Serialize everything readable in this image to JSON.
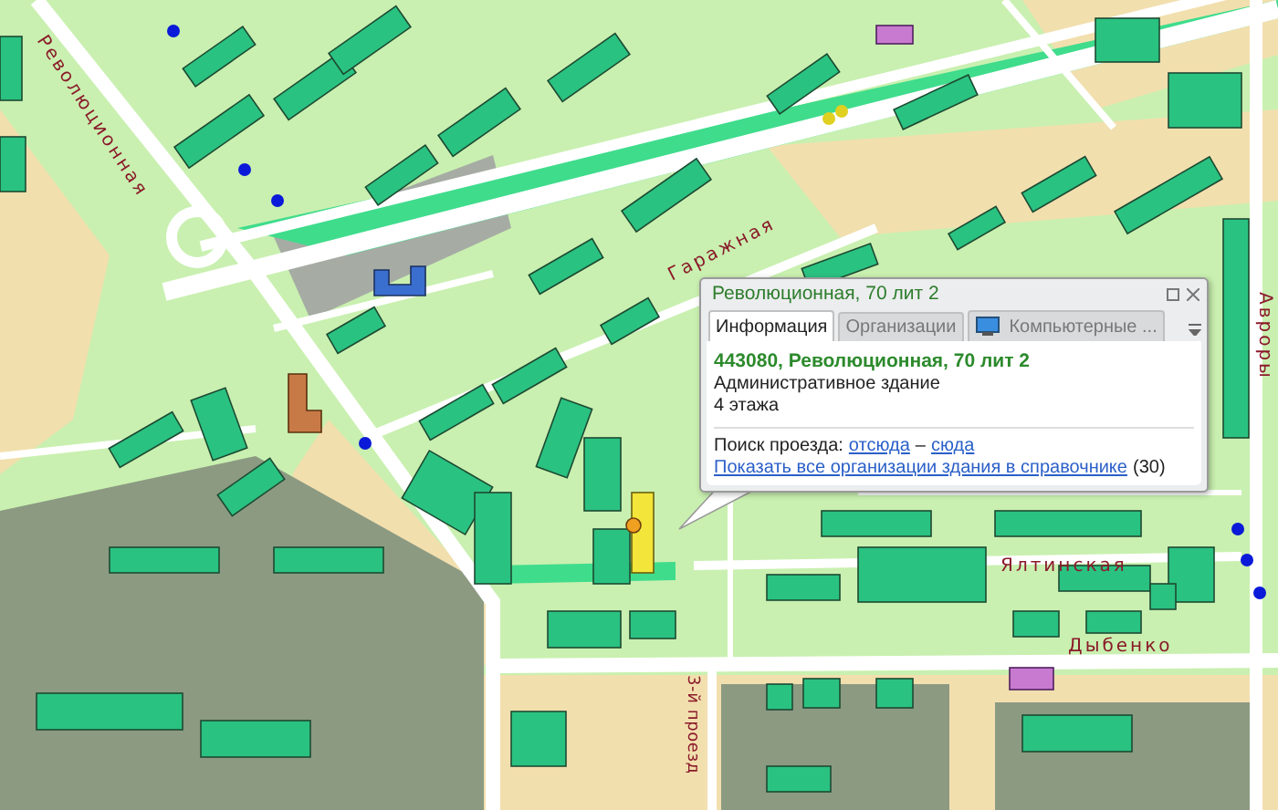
{
  "map": {
    "streets": [
      {
        "label": "Революционная",
        "kind": "diagonal"
      },
      {
        "label": "Гаражная",
        "kind": "slope"
      },
      {
        "label": "Ялтинская",
        "kind": "horizontal-mid"
      },
      {
        "label": "Дыбенко",
        "kind": "horizontal-low"
      },
      {
        "label": "Авроры",
        "kind": "vertical-right"
      },
      {
        "label": "3-й проезд",
        "kind": "vertical-low"
      }
    ]
  },
  "popup": {
    "title": "Революционная, 70 лит 2",
    "tabs": [
      {
        "label": "Информация",
        "selected": true,
        "kind": "text"
      },
      {
        "label": "Организации",
        "selected": false,
        "kind": "text"
      },
      {
        "label": "Компьютерные ...",
        "selected": false,
        "kind": "computer"
      }
    ],
    "address": "443080, Революционная, 70 лит 2",
    "building_type": "Административное здание",
    "floors": "4 этажа",
    "route_label": "Поиск проезда:",
    "route_from": "отсюда",
    "route_separator": "–",
    "route_to": "сюда",
    "show_all_link": "Показать все организации здания в справочнике",
    "count": "(30)"
  }
}
